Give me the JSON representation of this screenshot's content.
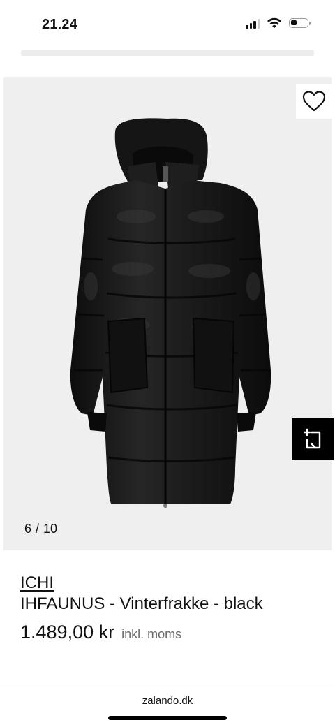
{
  "status_bar": {
    "time": "21.24",
    "signal_bars": 3,
    "signal_bars_total": 4,
    "wifi": "wifi-icon",
    "battery_level": 0.4
  },
  "gallery": {
    "current": "6",
    "separator": "/",
    "total": "10",
    "image_alt": "black-down-coat-product-photo",
    "colors": {
      "background": "#efefef",
      "coat": "#1a1a1a"
    }
  },
  "icons": {
    "wishlist": "heart-icon",
    "compare": "compare-icon"
  },
  "product": {
    "brand": "ICHI",
    "name": "IHFAUNUS - Vinterfrakke - black",
    "price": "1.489,00 kr",
    "vat_note": "inkl. moms"
  },
  "browser": {
    "url": "zalando.dk"
  }
}
